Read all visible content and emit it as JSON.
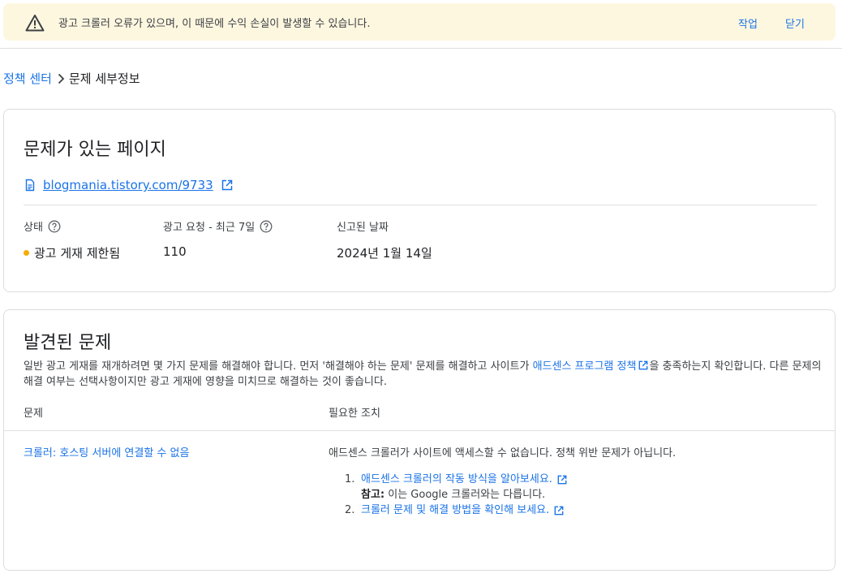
{
  "banner": {
    "icon": "warning-icon",
    "message": "광고 크롤러 오류가 있으며, 이 때문에 수익 손실이 발생할 수 있습니다.",
    "action_label": "작업",
    "close_label": "닫기"
  },
  "breadcrumb": {
    "parent": "정책 센터",
    "current": "문제 세부정보"
  },
  "page_card": {
    "title": "문제가 있는 페이지",
    "url": "blogmania.tistory.com/9733",
    "status_label": "상태",
    "status_value": "광고 게재 제한됨",
    "status_color": "#f9ab00",
    "requests_label": "광고 요청 - 최근 7일",
    "requests_value": "110",
    "reported_label": "신고된 날짜",
    "reported_value": "2024년 1월 14일"
  },
  "issues_card": {
    "title": "발견된 문제",
    "intro_before": "일반 광고 게재를 재개하려면 몇 가지 문제를 해결해야 합니다. 먼저 '해결해야 하는 문제' 문제를 해결하고 사이트가 ",
    "intro_link": "애드센스 프로그램 정책",
    "intro_after": "을 충족하는지 확인합니다. 다른 문제의 해결 여부는 선택사항이지만 광고 게재에 영향을 미치므로 해결하는 것이 좋습니다.",
    "col_issue": "문제",
    "col_action": "필요한 조치",
    "issue": "크롤러: 호스팅 서버에 연결할 수 없음",
    "action_text": "애드센스 크롤러가 사이트에 액세스할 수 없습니다. 정책 위반 문제가 아닙니다.",
    "steps": [
      {
        "num": "1.",
        "link": "애드센스 크롤러의 작동 방식을 알아보세요."
      },
      {
        "num": "2.",
        "link": "크롤러 문제 및 해결 방법을 확인해 보세요."
      }
    ],
    "note_label": "참고:",
    "note_text": " 이는 Google 크롤러와는 다릅니다."
  },
  "colors": {
    "link": "#1a73e8",
    "banner_bg": "#fef7e0"
  }
}
